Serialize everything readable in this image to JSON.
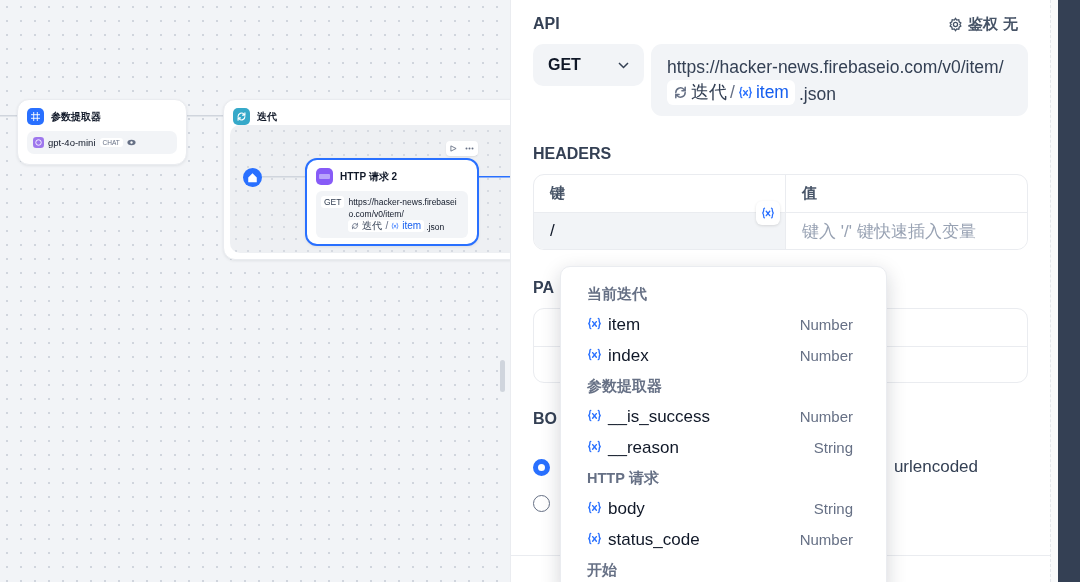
{
  "canvas": {
    "nodes": [
      {
        "kind": "extractor",
        "title": "参数提取器",
        "model": "gpt-4o-mini",
        "mode": "CHAT"
      },
      {
        "kind": "iteration",
        "title": "迭代",
        "child": {
          "title": "HTTP 请求 2",
          "method": "GET",
          "url": "https://hacker-news.firebaseio.com/v0/item/",
          "var_node": "迭代",
          "var_sep": "/",
          "var_name": "item",
          "suffix": ".json",
          "selected": true
        }
      }
    ]
  },
  "panel": {
    "api": {
      "title": "API",
      "auth_label": "鉴权",
      "auth_value": "无",
      "method": "GET",
      "url": "https://hacker-news.firebaseio.com/v0/item/",
      "var_node": "迭代",
      "var_sep": "/",
      "var_name": "item",
      "suffix": ".json"
    },
    "headers": {
      "title": "HEADERS",
      "columns": [
        "键",
        "值"
      ],
      "key_value": "/",
      "value_placeholder": "键入 '/' 键快速插入变量"
    },
    "params": {
      "title": "PA"
    },
    "body": {
      "title": "BO",
      "options": [
        {
          "selected": true
        },
        {
          "selected": false
        }
      ],
      "visible_label": "urlencoded"
    }
  },
  "dropdown": {
    "groups": [
      {
        "title": "当前迭代",
        "items": [
          {
            "name": "item",
            "type": "Number"
          },
          {
            "name": "index",
            "type": "Number"
          }
        ]
      },
      {
        "title": "参数提取器",
        "items": [
          {
            "name": "__is_success",
            "type": "Number"
          },
          {
            "name": "__reason",
            "type": "String"
          }
        ]
      },
      {
        "title": "HTTP 请求",
        "items": [
          {
            "name": "body",
            "type": "String"
          },
          {
            "name": "status_code",
            "type": "Number"
          }
        ]
      },
      {
        "title": "开始"
      }
    ]
  }
}
